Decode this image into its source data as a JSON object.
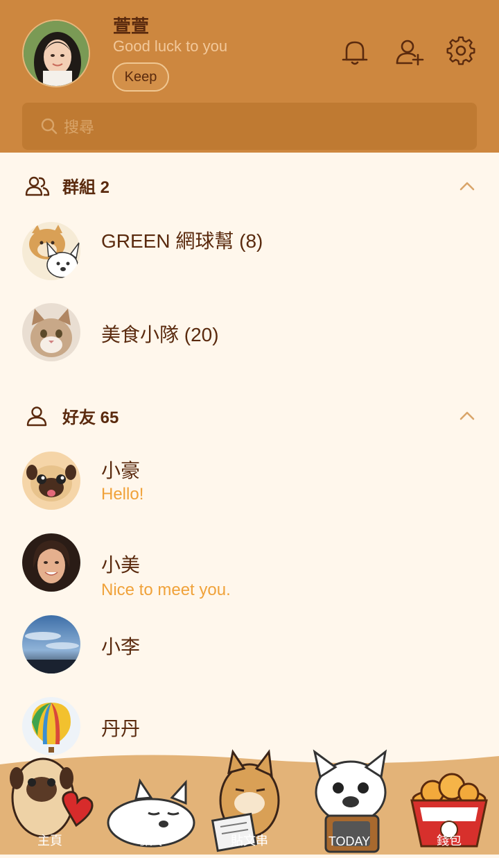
{
  "profile": {
    "name": "萱萱",
    "status": "Good luck to you",
    "keep_label": "Keep"
  },
  "search": {
    "placeholder": "搜尋"
  },
  "groups": {
    "title": "群組 2",
    "items": [
      {
        "name": "GREEN 網球幫 (8)"
      },
      {
        "name": "美食小隊 (20)"
      }
    ]
  },
  "friends": {
    "title": "好友 65",
    "items": [
      {
        "name": "小豪",
        "message": "Hello!"
      },
      {
        "name": "小美",
        "message": "Nice to meet you."
      },
      {
        "name": "小李",
        "message": ""
      },
      {
        "name": "丹丹",
        "message": ""
      }
    ]
  },
  "tabs": [
    {
      "label": "主頁",
      "icon": "pug-heart-icon"
    },
    {
      "label": "聊天",
      "icon": "sleeping-bulldog-icon"
    },
    {
      "label": "貼文串",
      "icon": "shiba-newspaper-icon"
    },
    {
      "label": "TODAY",
      "icon": "bulldog-tv-icon"
    },
    {
      "label": "錢包",
      "icon": "chicken-bucket-icon"
    }
  ],
  "colors": {
    "header": "#CD873F",
    "background": "#FFF7EC",
    "text_dark": "#5A2A0E",
    "accent": "#F0A23A"
  }
}
